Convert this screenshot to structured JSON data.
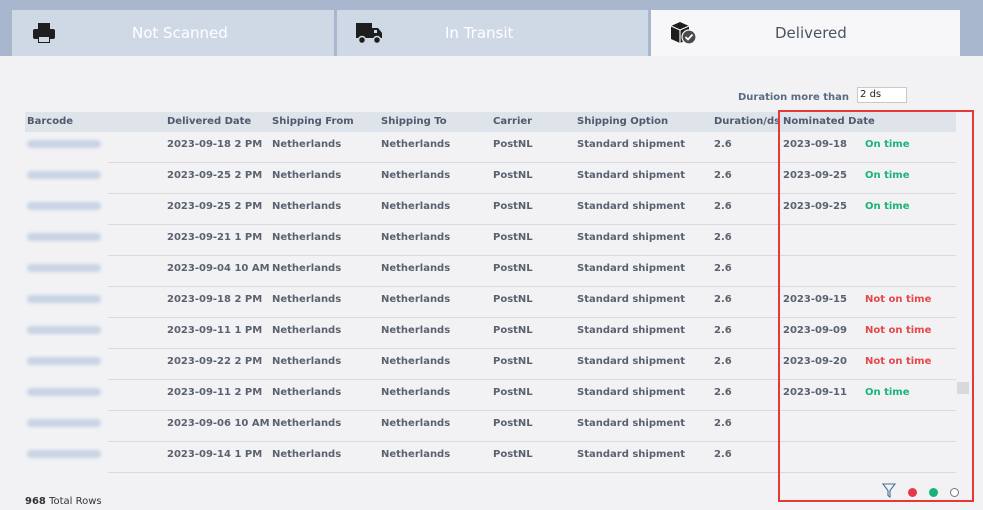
{
  "tabs": [
    {
      "label": "Not Scanned",
      "icon": "printer-icon"
    },
    {
      "label": "In Transit",
      "icon": "truck-icon"
    },
    {
      "label": "Delivered",
      "icon": "delivered-box-icon"
    }
  ],
  "filter": {
    "label": "Duration more than",
    "value": "2 ds"
  },
  "columns": [
    "Barcode",
    "Delivered Date",
    "Shipping From",
    "Shipping To",
    "Carrier",
    "Shipping Option",
    "Duration/ds",
    "Nominated Date"
  ],
  "rows": [
    {
      "delivered": "2023-09-18 2 PM",
      "from": "Netherlands",
      "to": "Netherlands",
      "carrier": "PostNL",
      "option": "Standard shipment",
      "duration": "2.6",
      "nominated": "2023-09-18",
      "status": "On time",
      "ontime": true
    },
    {
      "delivered": "2023-09-25 2 PM",
      "from": "Netherlands",
      "to": "Netherlands",
      "carrier": "PostNL",
      "option": "Standard shipment",
      "duration": "2.6",
      "nominated": "2023-09-25",
      "status": "On time",
      "ontime": true
    },
    {
      "delivered": "2023-09-25 2 PM",
      "from": "Netherlands",
      "to": "Netherlands",
      "carrier": "PostNL",
      "option": "Standard shipment",
      "duration": "2.6",
      "nominated": "2023-09-25",
      "status": "On time",
      "ontime": true
    },
    {
      "delivered": "2023-09-21 1 PM",
      "from": "Netherlands",
      "to": "Netherlands",
      "carrier": "PostNL",
      "option": "Standard shipment",
      "duration": "2.6",
      "nominated": "",
      "status": "",
      "ontime": null
    },
    {
      "delivered": "2023-09-04 10 AM",
      "from": "Netherlands",
      "to": "Netherlands",
      "carrier": "PostNL",
      "option": "Standard shipment",
      "duration": "2.6",
      "nominated": "",
      "status": "",
      "ontime": null
    },
    {
      "delivered": "2023-09-18 2 PM",
      "from": "Netherlands",
      "to": "Netherlands",
      "carrier": "PostNL",
      "option": "Standard shipment",
      "duration": "2.6",
      "nominated": "2023-09-15",
      "status": "Not on time",
      "ontime": false
    },
    {
      "delivered": "2023-09-11 1 PM",
      "from": "Netherlands",
      "to": "Netherlands",
      "carrier": "PostNL",
      "option": "Standard shipment",
      "duration": "2.6",
      "nominated": "2023-09-09",
      "status": "Not on time",
      "ontime": false
    },
    {
      "delivered": "2023-09-22 2 PM",
      "from": "Netherlands",
      "to": "Netherlands",
      "carrier": "PostNL",
      "option": "Standard shipment",
      "duration": "2.6",
      "nominated": "2023-09-20",
      "status": "Not on time",
      "ontime": false
    },
    {
      "delivered": "2023-09-11 2 PM",
      "from": "Netherlands",
      "to": "Netherlands",
      "carrier": "PostNL",
      "option": "Standard shipment",
      "duration": "2.6",
      "nominated": "2023-09-11",
      "status": "On time",
      "ontime": true
    },
    {
      "delivered": "2023-09-06 10 AM",
      "from": "Netherlands",
      "to": "Netherlands",
      "carrier": "PostNL",
      "option": "Standard shipment",
      "duration": "2.6",
      "nominated": "",
      "status": "",
      "ontime": null
    },
    {
      "delivered": "2023-09-14 1 PM",
      "from": "Netherlands",
      "to": "Netherlands",
      "carrier": "PostNL",
      "option": "Standard shipment",
      "duration": "2.6",
      "nominated": "",
      "status": "",
      "ontime": null
    }
  ],
  "footer": {
    "count": "968",
    "label": "Total Rows"
  },
  "legend": [
    {
      "name": "filter-icon"
    },
    {
      "name": "not-on-time-dot",
      "color": "#e53945"
    },
    {
      "name": "on-time-dot",
      "color": "#19b37a"
    },
    {
      "name": "no-date-dot",
      "color": "#ffffff"
    }
  ],
  "colors": {
    "on_time": "#19b37a",
    "not_on_time": "#e6474a",
    "highlight": "#e53935",
    "header_band": "#a8b7cd"
  }
}
